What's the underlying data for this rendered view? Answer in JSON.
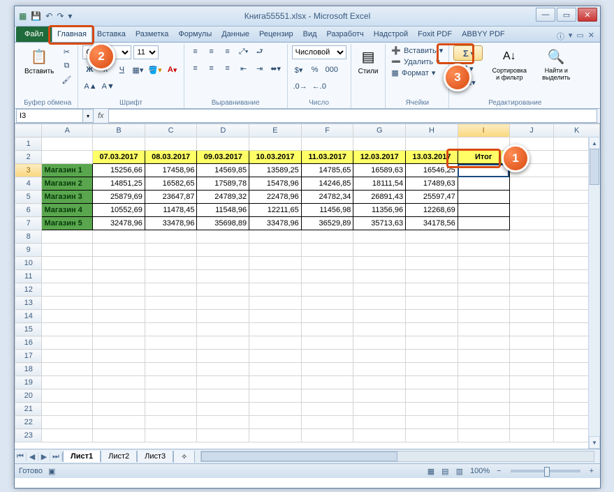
{
  "title": "Книга55551.xlsx - Microsoft Excel",
  "qat": {
    "save": "💾",
    "undo": "↶",
    "redo": "↷",
    "more": "▾"
  },
  "tabs": {
    "file": "Файл",
    "items": [
      "Главная",
      "Вставка",
      "Разметка",
      "Формулы",
      "Данные",
      "Рецензир",
      "Вид",
      "Разработч",
      "Надстрой",
      "Foxit PDF",
      "ABBYY PDF"
    ],
    "active_index": 0
  },
  "ribbon": {
    "clipboard": {
      "paste": "Вставить",
      "label": "Буфер обмена"
    },
    "font": {
      "name": "Calibri",
      "size": "11",
      "label": "Шрифт"
    },
    "align": {
      "label": "Выравнивание"
    },
    "number": {
      "format": "Числовой",
      "label": "Число"
    },
    "styles": {
      "btn": "Стили"
    },
    "cells": {
      "insert": "Вставить",
      "delete": "Удалить",
      "format": "Формат",
      "label": "Ячейки"
    },
    "editing": {
      "sort": "Сортировка и фильтр",
      "find": "Найти и выделить",
      "label": "Редактирование"
    }
  },
  "namebox": "I3",
  "columns": [
    "A",
    "B",
    "C",
    "D",
    "E",
    "F",
    "G",
    "H",
    "I",
    "J",
    "K"
  ],
  "headers": [
    "07.03.2017",
    "08.03.2017",
    "09.03.2017",
    "10.03.2017",
    "11.03.2017",
    "12.03.2017",
    "13.03.2017",
    "Итог"
  ],
  "rows": [
    {
      "store": "Магазин 1",
      "vals": [
        "15256,66",
        "17458,96",
        "14569,85",
        "13589,25",
        "14785,65",
        "16589,63",
        "16546,25"
      ]
    },
    {
      "store": "Магазин 2",
      "vals": [
        "14851,25",
        "16582,65",
        "17589,78",
        "15478,96",
        "14246,85",
        "18111,54",
        "17489,63"
      ]
    },
    {
      "store": "Магазин 3",
      "vals": [
        "25879,69",
        "23647,87",
        "24789,32",
        "22478,96",
        "24782,34",
        "26891,43",
        "25597,47"
      ]
    },
    {
      "store": "Магазин 4",
      "vals": [
        "10552,69",
        "11478,45",
        "11548,96",
        "12211,65",
        "11456,98",
        "11356,96",
        "12268,69"
      ]
    },
    {
      "store": "Магазин 5",
      "vals": [
        "32478,96",
        "33478,96",
        "35698,89",
        "33478,96",
        "36529,89",
        "35713,63",
        "34178,56"
      ]
    }
  ],
  "sheets": [
    "Лист1",
    "Лист2",
    "Лист3"
  ],
  "status": {
    "ready": "Готово",
    "zoom": "100%"
  },
  "callouts": {
    "c1": "1",
    "c2": "2",
    "c3": "3"
  }
}
